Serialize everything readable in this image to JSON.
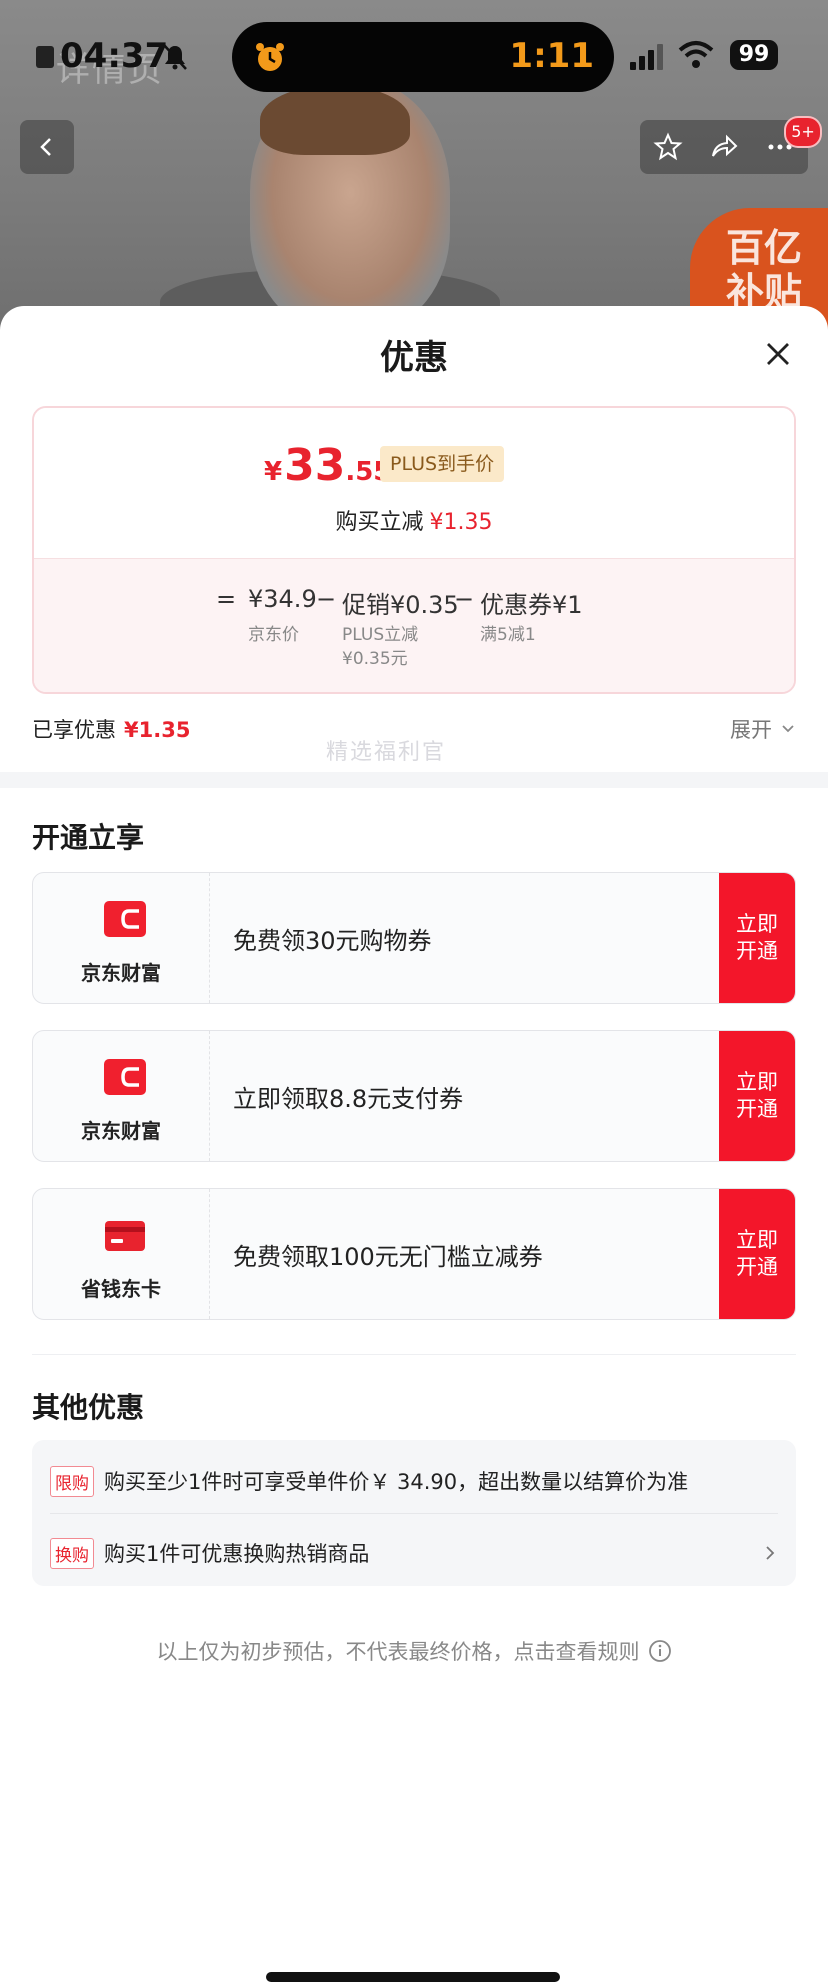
{
  "status_bar": {
    "time": "04:37",
    "island_timer": "1:11",
    "battery": "99"
  },
  "background": {
    "faded_text": "详情页",
    "subsidy_badge": "百亿\n补贴",
    "cart_badge": "5+"
  },
  "sheet": {
    "title": "优惠",
    "price": {
      "symbol": "¥",
      "integer": "33",
      "decimal": ".55",
      "tag": "PLUS到手价",
      "reduce_label": "购买立减",
      "reduce_amount": "¥1.35"
    },
    "breakdown": {
      "equals": "=",
      "base_price": "¥34.9",
      "base_label": "京东价",
      "minus1": "−",
      "promo": "促销¥0.35",
      "promo_label_1": "PLUS立减",
      "promo_label_2": "¥0.35元",
      "minus2": "−",
      "coupon": "优惠券¥1",
      "coupon_label": "满5减1"
    },
    "summary": {
      "label": "已享优惠",
      "amount": "¥1.35",
      "expand": "展开"
    },
    "open_section": {
      "title": "开通立享",
      "watermark": "精选福利官",
      "cards": [
        {
          "brand": "京东财富",
          "text": "免费领30元购物券",
          "button": "立即\n开通"
        },
        {
          "brand": "京东财富",
          "text": "立即领取8.8元支付券",
          "button": "立即\n开通"
        },
        {
          "brand": "省钱东卡",
          "text": "免费领取100元无门槛立减券",
          "button": "立即\n开通"
        }
      ]
    },
    "other_section": {
      "title": "其他优惠",
      "offers": [
        {
          "tag": "限购",
          "text": "购买至少1件时可享受单件价￥ 34.90，超出数量以结算价为准"
        },
        {
          "tag": "换购",
          "text": "购买1件可优惠换购热销商品"
        }
      ]
    },
    "disclaimer": "以上仅为初步预估，不代表最终价格，点击查看规则"
  },
  "colors": {
    "accent_red": "#e8232e",
    "button_red": "#f3162a",
    "plus_tag_bg": "#fbe9c9"
  }
}
